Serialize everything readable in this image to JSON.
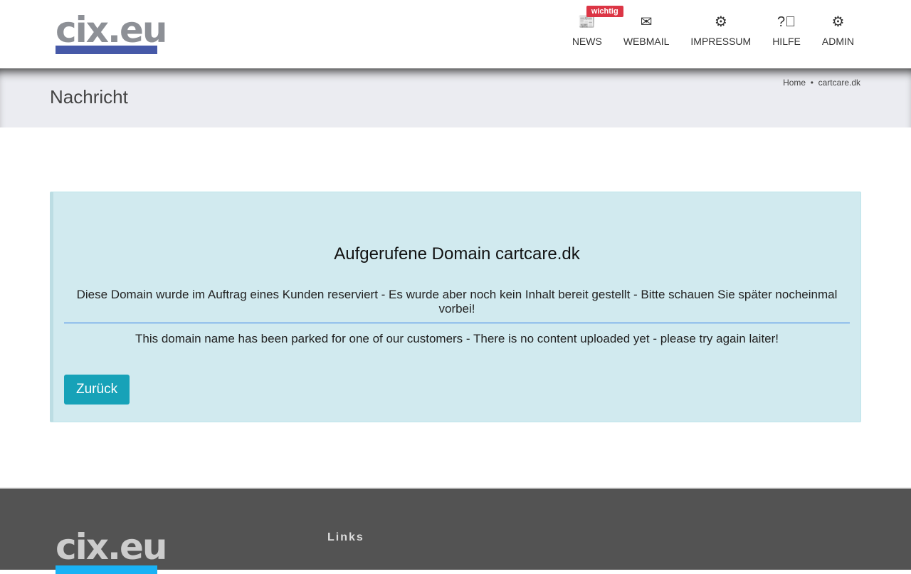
{
  "header": {
    "logo_text": "cix.eu",
    "nav": [
      {
        "label": "NEWS",
        "icon": "newspaper-icon",
        "badge": "wichtig"
      },
      {
        "label": "WEBMAIL",
        "icon": "envelope-icon"
      },
      {
        "label": "IMPRESSUM",
        "icon": "gears-icon"
      },
      {
        "label": "HILFE",
        "icon": "question-circle-icon"
      },
      {
        "label": "ADMIN",
        "icon": "gears-icon"
      }
    ]
  },
  "subheader": {
    "title": "Nachricht",
    "breadcrumb": [
      "Home",
      "cartcare.dk"
    ]
  },
  "message": {
    "heading": "Aufgerufene Domain cartcare.dk",
    "text_de": "Diese Domain wurde im Auftrag eines Kunden reserviert - Es wurde aber noch kein Inhalt bereit gestellt - Bitte schauen Sie später nocheinmal vorbei!",
    "text_en": "This domain name has been parked for one of our customers - There is no content uploaded yet - please try again laiter!",
    "back_button": "Zurück"
  },
  "footer": {
    "logo_text": "cix.eu",
    "links_title": "Links"
  }
}
